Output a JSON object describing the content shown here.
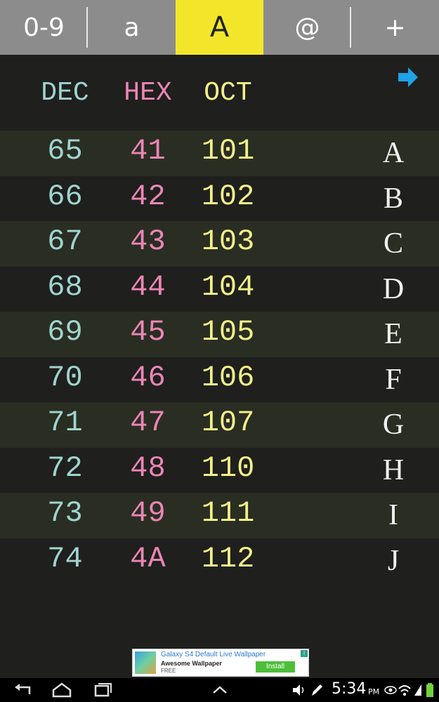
{
  "tabs": [
    {
      "label": "0-9",
      "active": false
    },
    {
      "label": "a",
      "active": false
    },
    {
      "label": "A",
      "active": true
    },
    {
      "label": "@",
      "active": false
    },
    {
      "label": "+",
      "active": false
    }
  ],
  "header": {
    "dec": "DEC",
    "hex": "HEX",
    "oct": "OCT"
  },
  "rows": [
    {
      "dec": "65",
      "hex": "41",
      "oct": "101",
      "char": "A"
    },
    {
      "dec": "66",
      "hex": "42",
      "oct": "102",
      "char": "B"
    },
    {
      "dec": "67",
      "hex": "43",
      "oct": "103",
      "char": "C"
    },
    {
      "dec": "68",
      "hex": "44",
      "oct": "104",
      "char": "D"
    },
    {
      "dec": "69",
      "hex": "45",
      "oct": "105",
      "char": "E"
    },
    {
      "dec": "70",
      "hex": "46",
      "oct": "106",
      "char": "F"
    },
    {
      "dec": "71",
      "hex": "47",
      "oct": "107",
      "char": "G"
    },
    {
      "dec": "72",
      "hex": "48",
      "oct": "110",
      "char": "H"
    },
    {
      "dec": "73",
      "hex": "49",
      "oct": "111",
      "char": "I"
    },
    {
      "dec": "74",
      "hex": "4A",
      "oct": "112",
      "char": "J"
    }
  ],
  "ad": {
    "title": "Galaxy S4 Default Live Wallpaper",
    "subtitle": "Awesome Wallpaper",
    "price": "FREE",
    "button": "Install"
  },
  "status": {
    "time": "5:34",
    "ampm": "PM"
  },
  "icons": {
    "next": "arrow-right-icon",
    "back": "back-icon",
    "home": "home-icon",
    "recents": "recents-icon",
    "up": "chevron-up-icon"
  },
  "colors": {
    "accent": "#f3e62a",
    "dec": "#9fd4d0",
    "hex": "#ea86b6",
    "oct": "#f2f08a",
    "arrow": "#1fa3e6"
  }
}
